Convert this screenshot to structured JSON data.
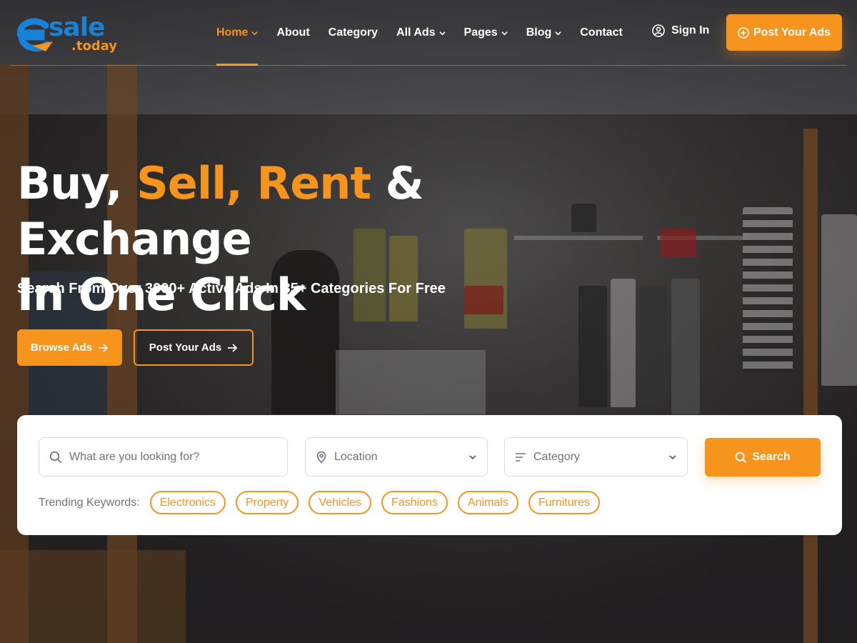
{
  "colors": {
    "accent": "#f7941d",
    "logo_blue": "#1a82d6"
  },
  "logo": {
    "word": "sale",
    "sub": ".today"
  },
  "nav": {
    "items": [
      {
        "label": "Home",
        "dropdown": true,
        "active": true
      },
      {
        "label": "About",
        "dropdown": false
      },
      {
        "label": "Category",
        "dropdown": false
      },
      {
        "label": "All Ads",
        "dropdown": true
      },
      {
        "label": "Pages",
        "dropdown": true
      },
      {
        "label": "Blog",
        "dropdown": true
      },
      {
        "label": "Contact",
        "dropdown": false
      }
    ],
    "signin_label": "Sign In",
    "post_label": "Post Your Ads"
  },
  "hero": {
    "title_part1": "Buy, ",
    "title_highlight": "Sell, Rent",
    "title_part2": " & Exchange",
    "title_line2": "In One Click",
    "subtitle": "Search From Over 3000+ Active Ads In 35+ Categories For Free",
    "browse_label": "Browse Ads",
    "post_label": "Post Your Ads"
  },
  "search": {
    "keyword_placeholder": "What are you looking for?",
    "location_value": "Location",
    "category_value": "Category",
    "button_label": "Search",
    "trending_label": "Trending Keywords:",
    "trending": [
      "Electronics",
      "Property",
      "Vehicles",
      "Fashions",
      "Animals",
      "Furnitures"
    ]
  },
  "icons": {
    "search": "search-icon",
    "location": "map-pin-icon",
    "category": "filter-lines-icon",
    "user": "user-circle-icon",
    "plus": "plus-circle-icon",
    "arrow": "arrow-right-icon",
    "chevron": "chevron-down-icon"
  }
}
